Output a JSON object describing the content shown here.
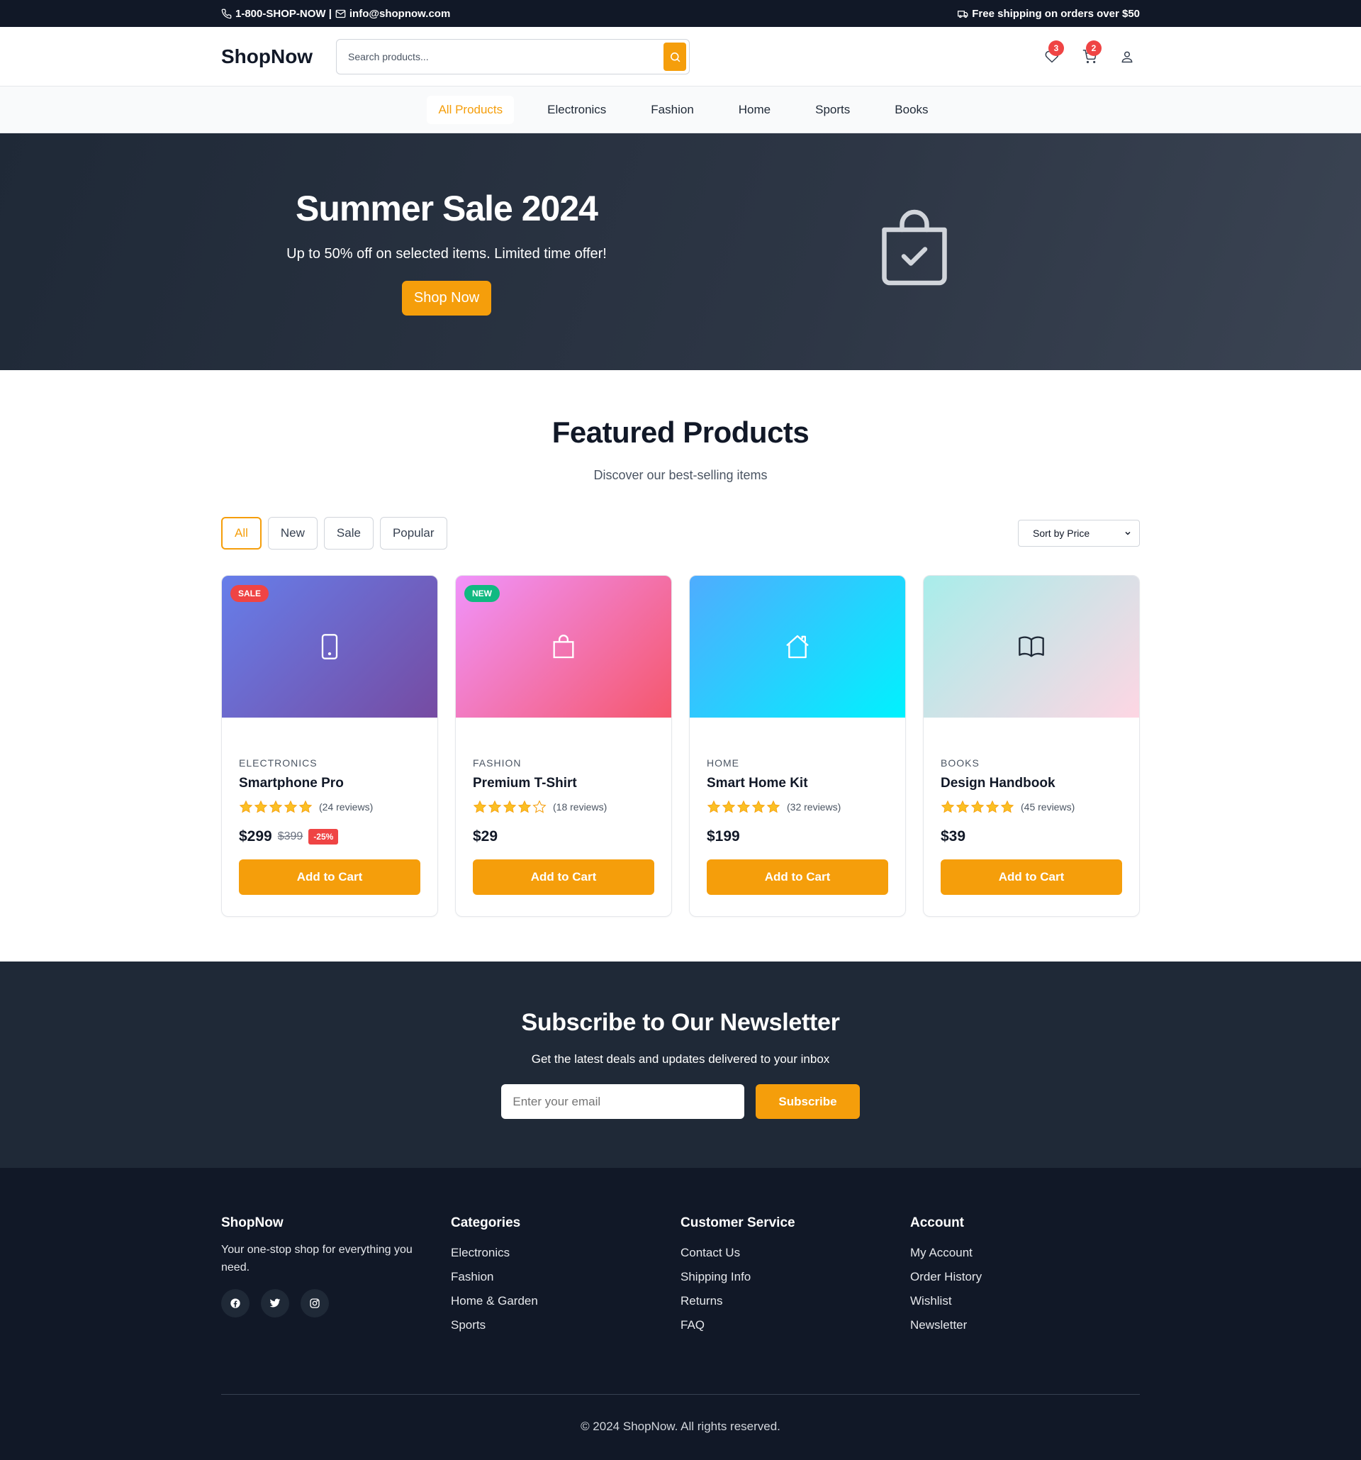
{
  "topbar": {
    "contact": "1-800-SHOP-NOW | ",
    "email": "info@shopnow.com",
    "shipping": "Free shipping on orders over $50"
  },
  "header": {
    "logo": "ShopNow",
    "search_placeholder": "Search products...",
    "wishlist_count": "3",
    "cart_count": "2"
  },
  "nav": {
    "items": [
      "All Products",
      "Electronics",
      "Fashion",
      "Home",
      "Sports",
      "Books"
    ],
    "active": "All Products"
  },
  "hero": {
    "title": "Summer Sale 2024",
    "subtitle": "Up to 50% off on selected items. Limited time offer!",
    "cta": "Shop Now",
    "icon": "shopping-bag-check-icon"
  },
  "featured": {
    "title": "Featured Products",
    "subtitle": "Discover our best-selling items",
    "filters": [
      "All",
      "New",
      "Sale",
      "Popular"
    ],
    "active_filter": "All",
    "sort_label": "Sort by Price",
    "add_to_cart": "Add to Cart",
    "products": [
      {
        "tag": "SALE",
        "tag_color": "#ef4444",
        "icon": "smartphone-icon",
        "category": "ELECTRONICS",
        "name": "Smartphone Pro",
        "rating": 5,
        "reviews": "(24 reviews)",
        "price": "$299",
        "old_price": "$399",
        "discount": "-25%"
      },
      {
        "tag": "NEW",
        "tag_color": "#10b981",
        "icon": "shopping-bag-icon",
        "category": "FASHION",
        "name": "Premium T-Shirt",
        "rating": 4,
        "reviews": "(18 reviews)",
        "price": "$29"
      },
      {
        "icon": "home-icon",
        "category": "HOME",
        "name": "Smart Home Kit",
        "rating": 5,
        "reviews": "(32 reviews)",
        "price": "$199"
      },
      {
        "icon": "book-icon",
        "category": "BOOKS",
        "name": "Design Handbook",
        "rating": 5,
        "reviews": "(45 reviews)",
        "price": "$39"
      }
    ]
  },
  "newsletter": {
    "title": "Subscribe to Our Newsletter",
    "subtitle": "Get the latest deals and updates delivered to your inbox",
    "placeholder": "Enter your email",
    "button": "Subscribe"
  },
  "footer": {
    "brand": "ShopNow",
    "description": "Your one-stop shop for everything you need.",
    "columns": [
      {
        "title": "Categories",
        "links": [
          "Electronics",
          "Fashion",
          "Home & Garden",
          "Sports"
        ]
      },
      {
        "title": "Customer Service",
        "links": [
          "Contact Us",
          "Shipping Info",
          "Returns",
          "FAQ"
        ]
      },
      {
        "title": "Account",
        "links": [
          "My Account",
          "Order History",
          "Wishlist",
          "Newsletter"
        ]
      }
    ],
    "socials": [
      "facebook-icon",
      "twitter-icon",
      "instagram-icon"
    ],
    "copyright": "© 2024 ShopNow. All rights reserved."
  },
  "colors": {
    "accent": "#f59e0b",
    "dark": "#111827",
    "hero_bg": "#1f2937",
    "badge": "#ef4444"
  }
}
